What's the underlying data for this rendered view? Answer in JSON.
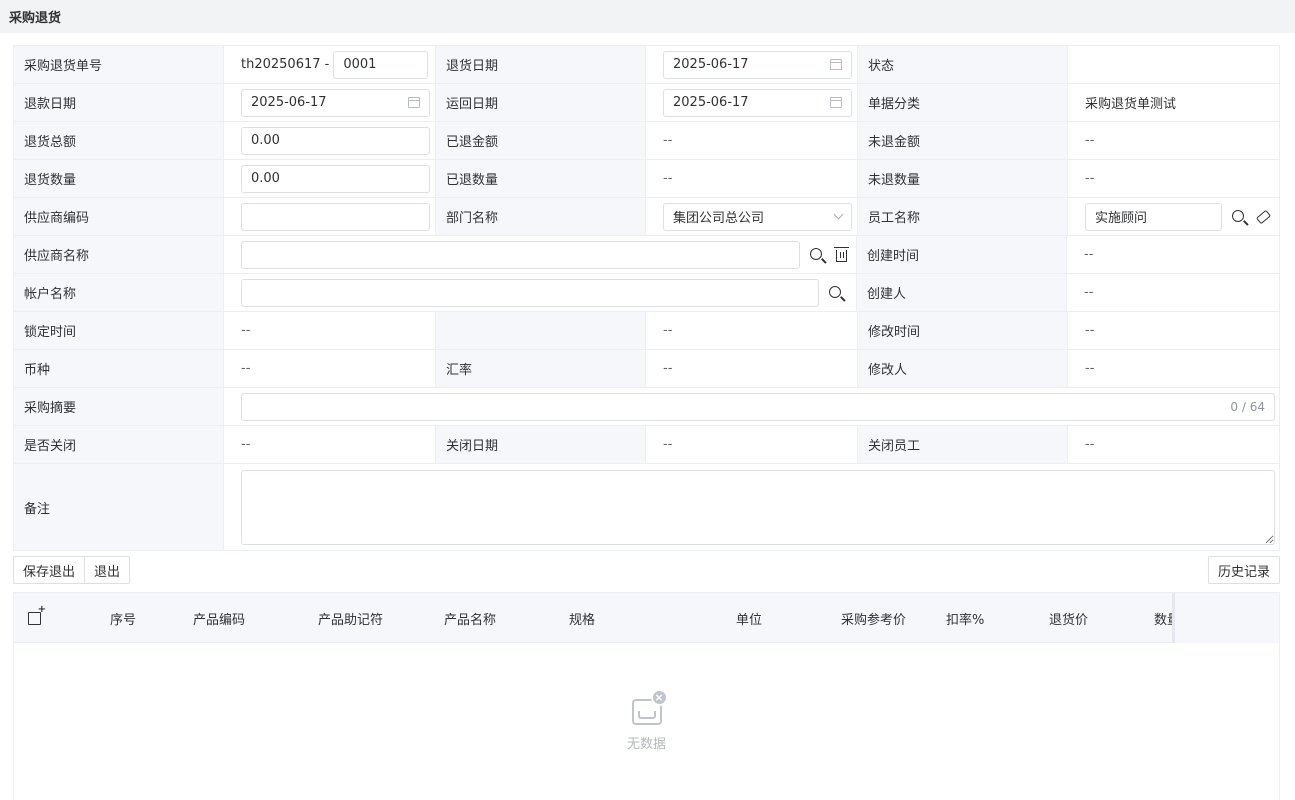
{
  "page": {
    "title": "采购退货"
  },
  "form": {
    "return_no_label": "采购退货单号",
    "return_no_prefix": "th20250617 -",
    "return_no_suffix": "0001",
    "return_date_label": "退货日期",
    "return_date": "2025-06-17",
    "status_label": "状态",
    "status_value": "",
    "refund_date_label": "退款日期",
    "refund_date": "2025-06-17",
    "ship_back_date_label": "运回日期",
    "ship_back_date": "2025-06-17",
    "doc_category_label": "单据分类",
    "doc_category": "采购退货单测试",
    "return_total_label": "退货总额",
    "return_total": "0.00",
    "refunded_amount_label": "已退金额",
    "refunded_amount": "--",
    "unrefunded_amount_label": "未退金额",
    "unrefunded_amount": "--",
    "return_qty_label": "退货数量",
    "return_qty": "0.00",
    "returned_qty_label": "已退数量",
    "returned_qty": "--",
    "unreturned_qty_label": "未退数量",
    "unreturned_qty": "--",
    "supplier_code_label": "供应商编码",
    "supplier_code": "",
    "dept_label": "部门名称",
    "dept_value": "集团公司总公司",
    "employee_label": "员工名称",
    "employee_value": "实施顾问",
    "supplier_name_label": "供应商名称",
    "supplier_name": "",
    "created_time_label": "创建时间",
    "created_time": "--",
    "account_name_label": "帐户名称",
    "account_name": "",
    "creator_label": "创建人",
    "creator": "--",
    "lock_time_label": "锁定时间",
    "lock_time": "--",
    "blank_label": "",
    "blank_value": "--",
    "modified_time_label": "修改时间",
    "modified_time": "--",
    "currency_label": "币种",
    "currency": "--",
    "exchange_rate_label": "汇率",
    "exchange_rate": "--",
    "modifier_label": "修改人",
    "modifier": "--",
    "summary_label": "采购摘要",
    "summary_value": "",
    "summary_counter": "0 / 64",
    "closed_label": "是否关闭",
    "closed_value": "--",
    "close_date_label": "关闭日期",
    "close_date": "--",
    "close_employee_label": "关闭员工",
    "close_employee": "--",
    "remark_label": "备注",
    "remark_value": ""
  },
  "toolbar": {
    "save_exit_label": "保存退出",
    "exit_label": "退出",
    "history_label": "历史记录"
  },
  "grid": {
    "columns": [
      "序号",
      "产品编码",
      "产品助记符",
      "产品名称",
      "规格",
      "单位",
      "采购参考价",
      "扣率%",
      "退货价",
      "数量"
    ],
    "empty_text": "无数据"
  }
}
